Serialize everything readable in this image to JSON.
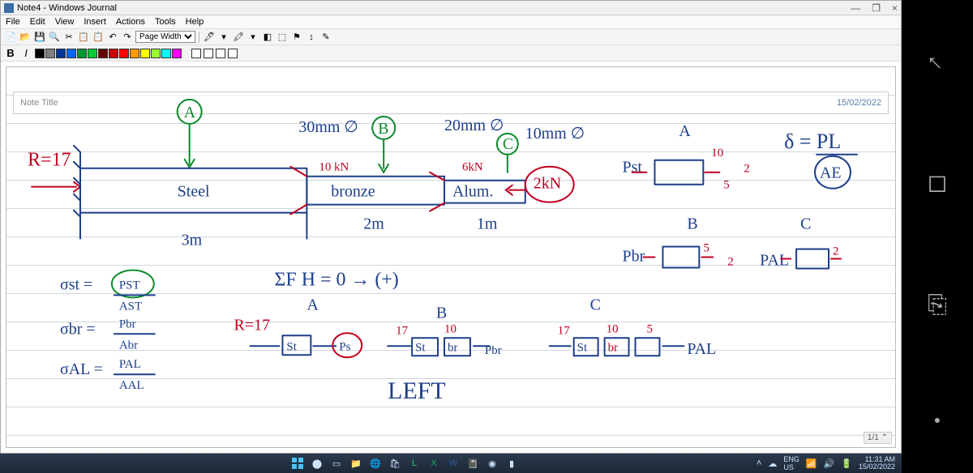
{
  "window": {
    "title": "Note4 - Windows Journal",
    "min": "—",
    "restore": "❐",
    "close": "×"
  },
  "menu": {
    "file": "File",
    "edit": "Edit",
    "view": "View",
    "insert": "Insert",
    "actions": "Actions",
    "tools": "Tools",
    "help": "Help"
  },
  "toolbar": {
    "zoom_select": "Page Width",
    "bold": "B",
    "italic": "I"
  },
  "swatch_colors": [
    "#000000",
    "#808080",
    "#003399",
    "#0066ff",
    "#009933",
    "#00cc33",
    "#660000",
    "#cc0000",
    "#ff0000",
    "#ff9900",
    "#ffff00",
    "#99ff33",
    "#00ffff",
    "#ff00ff"
  ],
  "canvas": {
    "title_placeholder": "Note Title",
    "date": "15/02/2022",
    "page_indicator": "1/1"
  },
  "ink_text": {
    "nodeA": "A",
    "thirty_mm": "30mm ∅",
    "nodeB": "B",
    "twenty_mm": "20mm ∅",
    "nodeC": "C",
    "ten_mm": "10mm ∅",
    "nodeA_right": "A",
    "r17": "R=17",
    "steel": "Steel",
    "ten_kn": "10 kN",
    "bronze": "bronze",
    "six_kn": "6kN",
    "alum": "Alum.",
    "two_kn": "2kN",
    "pst_box": "Pst",
    "ten_val": "10",
    "five_val": "5",
    "two_val": "2",
    "three_m": "3m",
    "two_m": "2m",
    "one_m": "1m",
    "nodeB_low": "B",
    "pbr_box": "Pbr",
    "nodeC_right": "C",
    "pal_box": "PAL",
    "sigma_st": "σst =",
    "pst_frac_top": "PST",
    "pst_frac_bot": "AST",
    "sigma_br": "σbr =",
    "pbr_frac_top": "Pbr",
    "pbr_frac_bot": "Abr",
    "sigma_al": "σAL =",
    "pal_frac_top": "PAL",
    "pal_frac_bot": "AAL",
    "sumfh": "ΣF H = 0  → (+)",
    "A_mark": "A",
    "B_mark": "B",
    "C_mark": "C",
    "r17b": "R=17",
    "seventeen_a": "17",
    "seventeen_b": "17",
    "st_box": "St",
    "ps_circ": "Ps",
    "st2": "St",
    "br2": "br",
    "pbr_lbl": "Pbr",
    "ten_b": "10",
    "five_b": "5",
    "pal_lbl": "PAL",
    "left_big": "LEFT",
    "delta_eq": "δ = PL",
    "ae": "AE",
    "two_r1": "2",
    "two_r2": "2"
  },
  "tray": {
    "lang": "ENG\nUS",
    "time": "11:31 AM",
    "tdate": "15/02/2022"
  },
  "nav": {
    "back": "←",
    "square": "◻",
    "recent": "⎘",
    "dot": "●"
  }
}
